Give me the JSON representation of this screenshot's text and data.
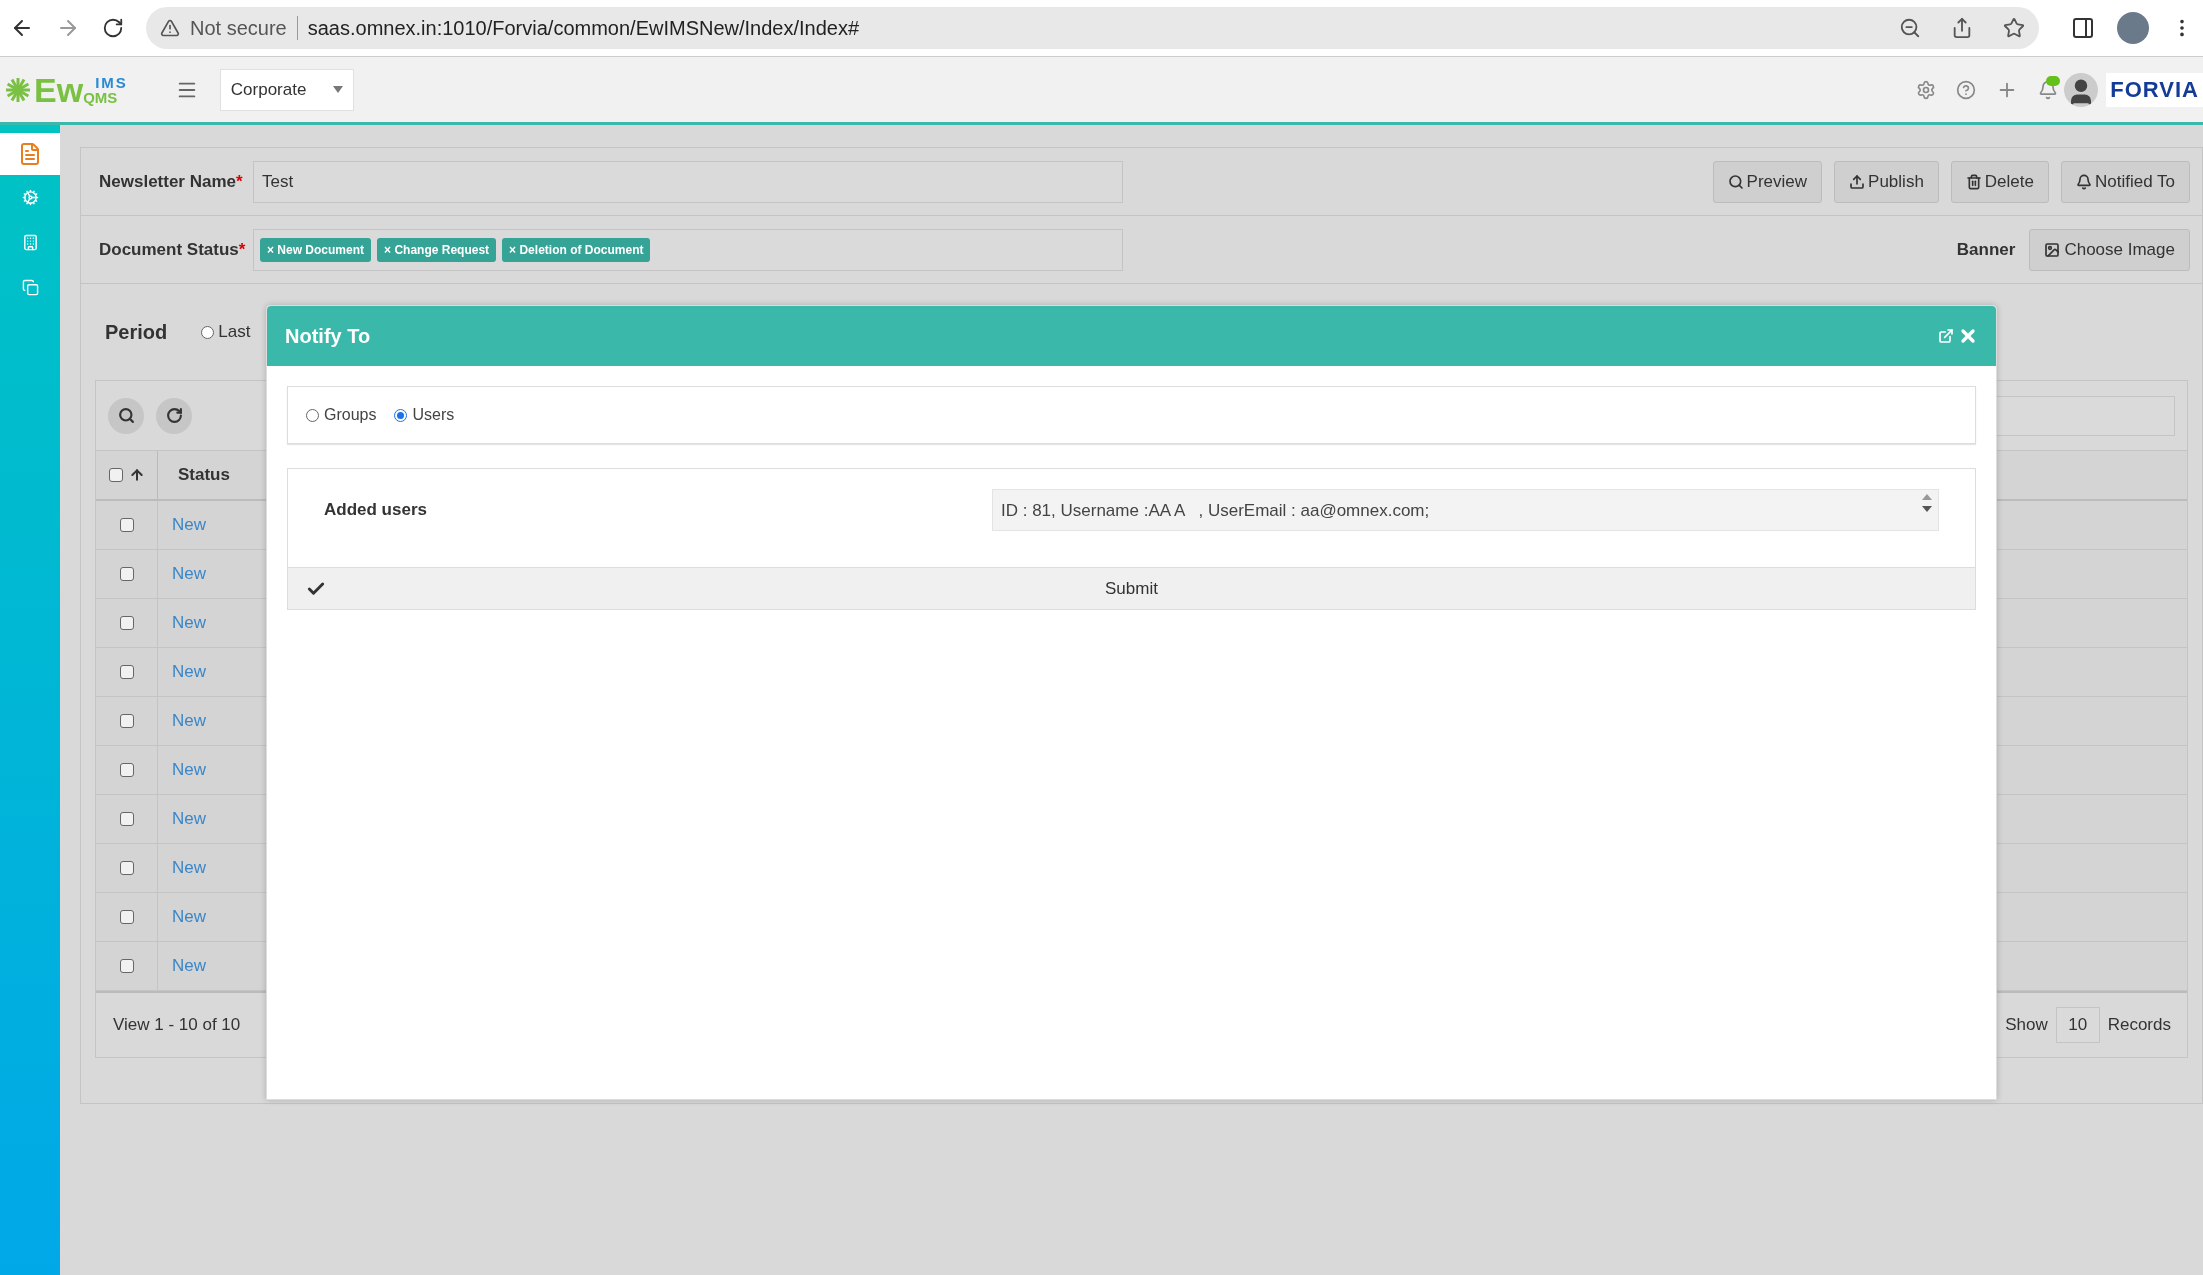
{
  "browser": {
    "security": "Not secure",
    "url": "saas.omnex.in:1010/Forvia/common/EwIMSNew/Index/Index#"
  },
  "header": {
    "logo_main": "Ew",
    "logo_top": "IMS",
    "logo_bottom": "QMS",
    "site": "Corporate",
    "brand": "FORVIA"
  },
  "sidebar": {
    "items": [
      {
        "kind": "newsletter",
        "selected": true
      },
      {
        "kind": "settings",
        "selected": false
      },
      {
        "kind": "building",
        "selected": false
      },
      {
        "kind": "copy",
        "selected": false
      }
    ]
  },
  "form": {
    "name_label": "Newsletter Name",
    "required_mark": "*",
    "name_value": "Test",
    "buttons": [
      {
        "kind": "preview",
        "label": "Preview"
      },
      {
        "kind": "publish",
        "label": "Publish"
      },
      {
        "kind": "delete",
        "label": "Delete"
      },
      {
        "kind": "notify",
        "label": "Notified To"
      }
    ],
    "status_label": "Document Status",
    "status_required_mark": "*",
    "tags": [
      "New Document",
      "Change Request",
      "Deletion of Document"
    ],
    "remove_mark": "×",
    "banner_label": "Banner",
    "choose_image": "Choose Image",
    "period_label": "Period",
    "period_option": {
      "label": "Last",
      "selected": false
    }
  },
  "table": {
    "columns": [
      "Status"
    ],
    "all_checked": false,
    "rows": [
      {
        "checked": false,
        "status": "New"
      },
      {
        "checked": false,
        "status": "New"
      },
      {
        "checked": false,
        "status": "New"
      },
      {
        "checked": false,
        "status": "New"
      },
      {
        "checked": false,
        "status": "New"
      },
      {
        "checked": false,
        "status": "New"
      },
      {
        "checked": false,
        "status": "New"
      },
      {
        "checked": false,
        "status": "New"
      },
      {
        "checked": false,
        "status": "New"
      },
      {
        "checked": false,
        "status": "New"
      }
    ],
    "footer": "View 1 - 10 of 10",
    "show": "Show",
    "page_size": "10",
    "records": "Records"
  },
  "modal": {
    "title": "Notify To",
    "options": [
      {
        "label": "Groups",
        "selected": false
      },
      {
        "label": "Users",
        "selected": true
      }
    ],
    "added_users_label": "Added users",
    "added_users_value": "ID : 81, Username :AA A   , UserEmail : aa@omnex.com;",
    "submit": "Submit"
  }
}
